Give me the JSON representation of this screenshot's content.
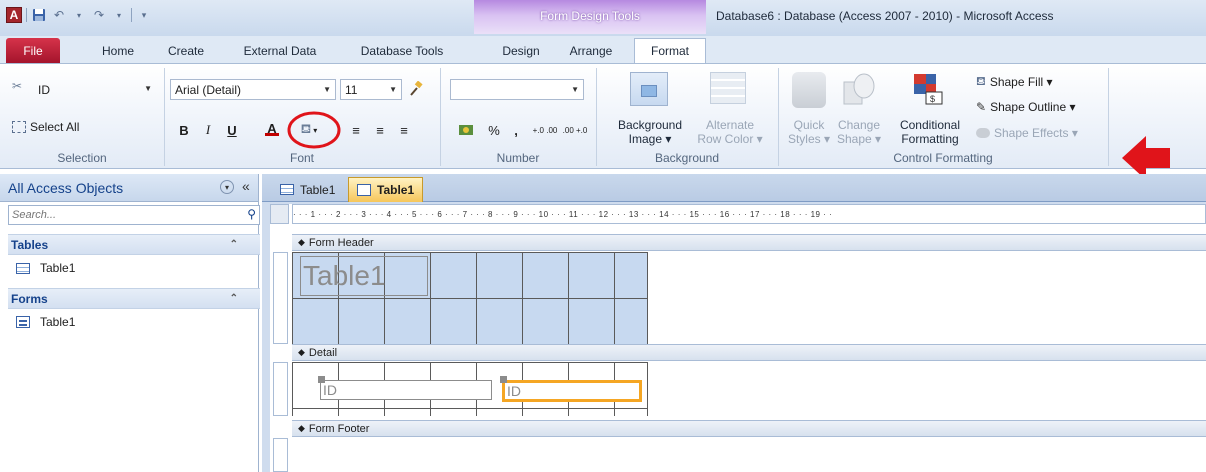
{
  "titlebar": {
    "app_icon_letter": "A",
    "contextual_label": "Form Design Tools",
    "window_title": "Database6 : Database (Access 2007 - 2010)  -  Microsoft Access"
  },
  "tabs": [
    "File",
    "Home",
    "Create",
    "External Data",
    "Database Tools",
    "Design",
    "Arrange",
    "Format"
  ],
  "ribbon": {
    "selection": {
      "object_value": "ID",
      "select_all": "Select All",
      "label": "Selection"
    },
    "font": {
      "family": "Arial (Detail)",
      "size": "11",
      "bold": "B",
      "italic": "I",
      "underline": "U",
      "font_color_glyph": "A",
      "label": "Font"
    },
    "number": {
      "format_value": "",
      "percent": "%",
      "comma": ",",
      "inc_decimals": "+.0 .00",
      "dec_decimals": ".00 +.0",
      "label": "Number"
    },
    "background": {
      "bg_image_line1": "Background",
      "bg_image_line2": "Image ▾",
      "alt_row_line1": "Alternate",
      "alt_row_line2": "Row Color ▾",
      "label": "Background"
    },
    "control_formatting": {
      "quick_styles_line1": "Quick",
      "quick_styles_line2": "Styles ▾",
      "change_shape_line1": "Change",
      "change_shape_line2": "Shape ▾",
      "conditional_line1": "Conditional",
      "conditional_line2": "Formatting",
      "shape_fill": "Shape Fill ▾",
      "shape_outline": "Shape Outline ▾",
      "shape_effects": "Shape Effects ▾",
      "label": "Control Formatting"
    }
  },
  "navpane": {
    "title": "All Access Objects",
    "search_placeholder": "Search...",
    "sections": [
      {
        "label": "Tables",
        "items": [
          "Table1"
        ]
      },
      {
        "label": "Forms",
        "items": [
          "Table1"
        ]
      }
    ]
  },
  "document": {
    "tabs": [
      "Table1",
      "Table1"
    ],
    "ruler_text": "· · · 1 · · · 2 · · · 3 · · · 4 · · · 5 · · · 6 · · · 7 · · · 8 · · · 9 · · · 10 · · · 11 · · · 12 · · · 13 · · · 14 · · · 15 · · · 16 · · · 17 · · · 18 · · · 19 · ·",
    "sections": {
      "header": "Form Header",
      "detail": "Detail",
      "footer": "Form Footer"
    },
    "header_title_label": "Table1",
    "detail_label": "ID",
    "detail_textbox": "ID"
  },
  "colors": {
    "file_tab": "#b5162f",
    "contextual": "#b689e0",
    "annotation_red": "#e0141a",
    "selection_orange": "#f5a623",
    "header_grid": "#c7d9f0"
  }
}
